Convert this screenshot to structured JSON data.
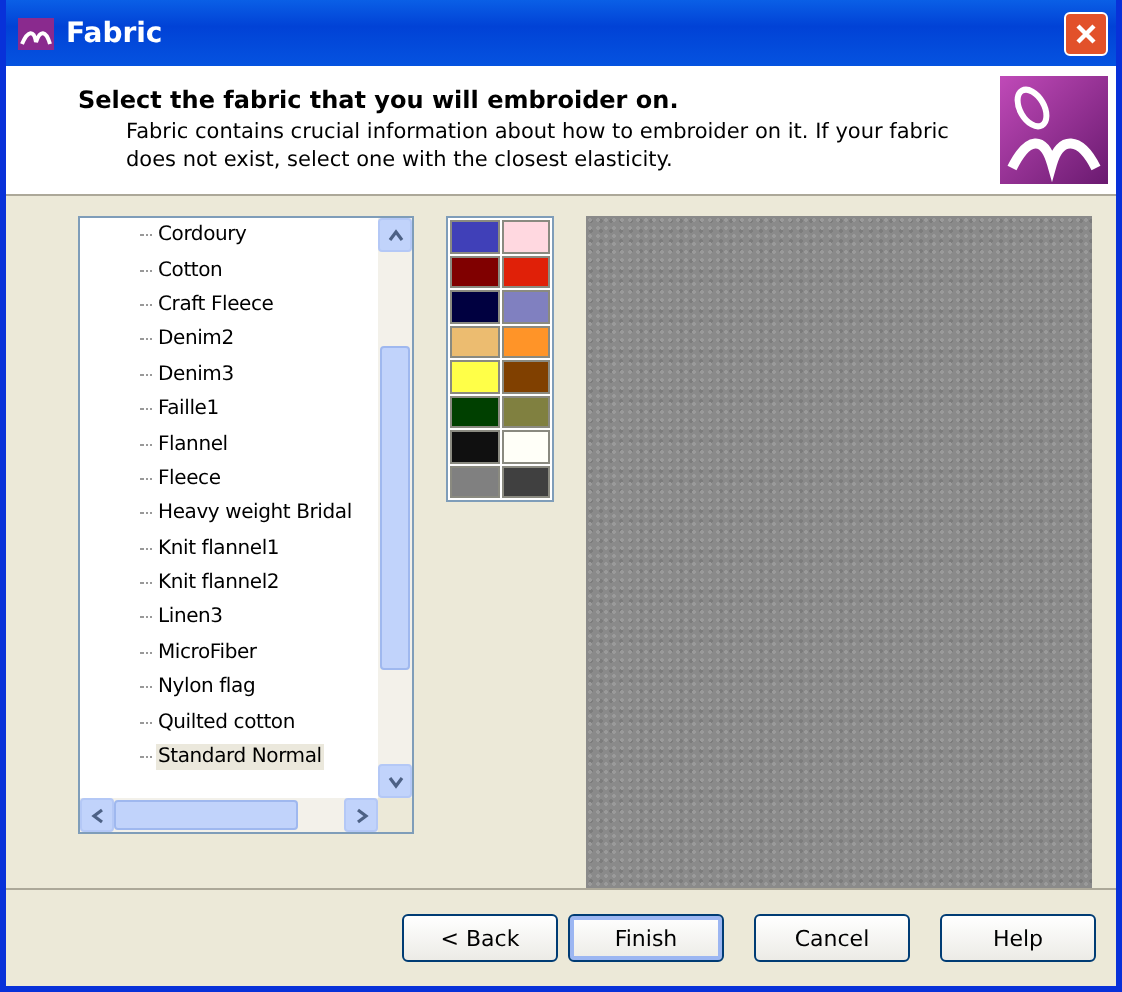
{
  "window": {
    "title": "Fabric"
  },
  "header": {
    "heading": "Select the fabric that you will embroider on.",
    "description": "Fabric contains crucial information about how to embroider on it. If your fabric does not exist, select one with the closest elasticity."
  },
  "fabrics": [
    {
      "label": "Cordoury",
      "selected": false
    },
    {
      "label": "Cotton",
      "selected": false
    },
    {
      "label": "Craft Fleece",
      "selected": false
    },
    {
      "label": "Denim2",
      "selected": false
    },
    {
      "label": "Denim3",
      "selected": false
    },
    {
      "label": "Faille1",
      "selected": false
    },
    {
      "label": "Flannel",
      "selected": false
    },
    {
      "label": "Fleece",
      "selected": false
    },
    {
      "label": "Heavy weight Bridal",
      "selected": false
    },
    {
      "label": "Knit flannel1",
      "selected": false
    },
    {
      "label": "Knit flannel2",
      "selected": false
    },
    {
      "label": "Linen3",
      "selected": false
    },
    {
      "label": "MicroFiber",
      "selected": false
    },
    {
      "label": "Nylon flag",
      "selected": false
    },
    {
      "label": "Quilted cotton",
      "selected": false
    },
    {
      "label": "Standard Normal",
      "selected": true
    }
  ],
  "swatches": [
    {
      "color": "#4040b8"
    },
    {
      "color": "#ffd8e0"
    },
    {
      "color": "#800000"
    },
    {
      "color": "#e02008"
    },
    {
      "color": "#000040"
    },
    {
      "color": "#8080c0"
    },
    {
      "color": "#ecbc70"
    },
    {
      "color": "#ff9428"
    },
    {
      "color": "#ffff48"
    },
    {
      "color": "#804000"
    },
    {
      "color": "#004000"
    },
    {
      "color": "#808040"
    },
    {
      "color": "#101010"
    },
    {
      "color": "#fffff8"
    },
    {
      "color": "#808080"
    },
    {
      "color": "#404040"
    }
  ],
  "buttons": [
    {
      "label": "< Back"
    },
    {
      "label": "Finish",
      "default": true
    },
    {
      "label": "Cancel"
    },
    {
      "label": "Help"
    }
  ]
}
